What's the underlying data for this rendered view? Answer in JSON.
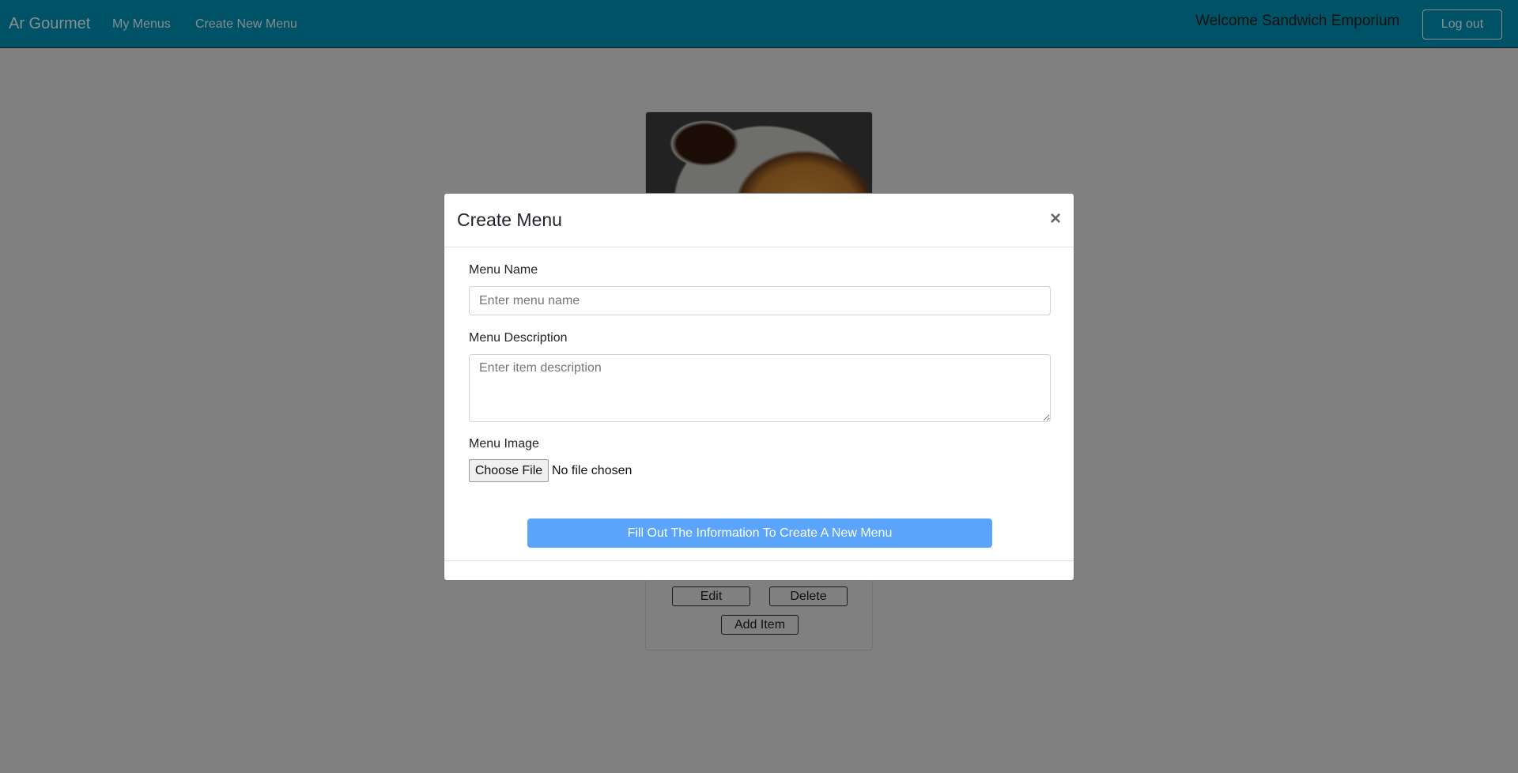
{
  "navbar": {
    "brand": "Ar Gourmet",
    "links": [
      "My Menus",
      "Create New Menu"
    ],
    "welcome": "Welcome Sandwich Emporium",
    "logout": "Log out",
    "color": "#005366"
  },
  "card": {
    "image_alt": "pancakes with syrup",
    "buttons": {
      "edit": "Edit",
      "delete": "Delete",
      "add_item": "Add Item"
    }
  },
  "modal": {
    "title": "Create Menu",
    "close": "×",
    "fields": {
      "name_label": "Menu Name",
      "name_placeholder": "Enter menu name",
      "name_value": "",
      "desc_label": "Menu Description",
      "desc_placeholder": "Enter item description",
      "desc_value": "",
      "image_label": "Menu Image",
      "file_button": "Choose File",
      "file_status": "No file chosen"
    },
    "submit": "Fill Out The Information To Create A New Menu",
    "submit_color": "#5ba4fc"
  }
}
